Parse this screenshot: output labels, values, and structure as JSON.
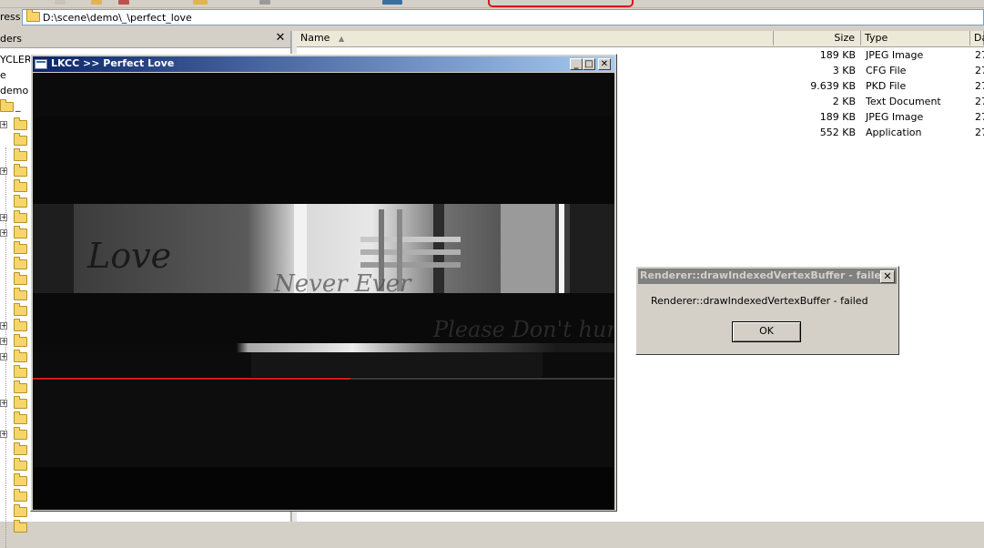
{
  "address": {
    "label": "ress",
    "path": "D:\\scene\\demo\\_\\perfect_love"
  },
  "folders_pane": {
    "title": "ders",
    "close": "✕",
    "items": [
      "YCLER",
      "e",
      "demo",
      "_"
    ]
  },
  "file_list": {
    "columns": {
      "name": "Name",
      "size": "Size",
      "type": "Type",
      "date": "Da"
    },
    "rows": [
      {
        "size": "189 KB",
        "type": "JPEG Image",
        "date": "27"
      },
      {
        "size": "3 KB",
        "type": "CFG File",
        "date": "27"
      },
      {
        "size": "9.639 KB",
        "type": "PKD File",
        "date": "27"
      },
      {
        "size": "2 KB",
        "type": "Text Document",
        "date": "27"
      },
      {
        "size": "189 KB",
        "type": "JPEG Image",
        "date": "27"
      },
      {
        "size": "552 KB",
        "type": "Application",
        "date": "27"
      }
    ]
  },
  "app_window": {
    "title": "LKCC >> Perfect Love",
    "scene_text": {
      "love": "Love",
      "never": "Never Ever",
      "please": "Please Don't hurt me"
    }
  },
  "dialog": {
    "title": "Renderer::drawIndexedVertexBuffer - failed",
    "message": "Renderer::drawIndexedVertexBuffer - failed",
    "ok_label": "OK",
    "close": "✕"
  },
  "colors": {
    "title_active": "#0a246a",
    "title_inactive": "#808080",
    "highlight_red": "#d31a1a",
    "folder_yellow": "#f6d66b"
  }
}
